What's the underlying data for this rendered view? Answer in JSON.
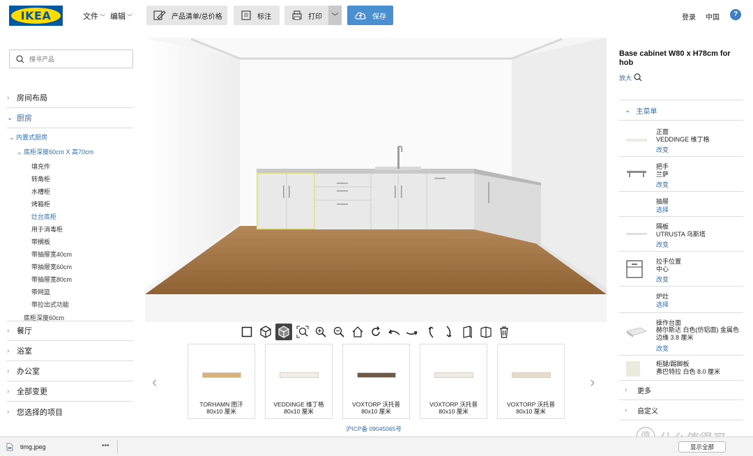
{
  "topbar": {
    "logo_text": "IKEA",
    "menu_file": "文件",
    "menu_edit": "编辑",
    "btn_list": "产品清单/总价格",
    "btn_mark": "标注",
    "btn_print": "打印",
    "btn_save": "保存",
    "login": "登录",
    "region": "中国",
    "help": "?"
  },
  "sidebar": {
    "search_placeholder": "搜寻产品",
    "categories": [
      {
        "label": "房间布局"
      },
      {
        "label": "厨房"
      },
      {
        "label": "餐厅"
      },
      {
        "label": "浴室"
      },
      {
        "label": "办公室"
      },
      {
        "label": "全部变更"
      },
      {
        "label": "您选择的项目"
      }
    ],
    "builtin": "内置式厨房",
    "base_depth": "底柜深度60cm X 高70cm",
    "items": [
      "填充件",
      "转角柜",
      "水槽柜",
      "烤箱柜",
      "灶台底柜",
      "用于消毒柜",
      "带搁板",
      "带抽屉宽40cm",
      "带抽屉宽60cm",
      "带抽屉宽80cm",
      "带网篮",
      "带拉出式功能"
    ],
    "base_depth_2": "底柜深度60cm"
  },
  "cards": [
    {
      "name": "TORHAMN 图汗",
      "size": "80x10 厘米"
    },
    {
      "name": "VEDDINGE 维丁格",
      "size": "80x10 厘米"
    },
    {
      "name": "VOXTORP 沃托普",
      "size": "80x10 厘米"
    },
    {
      "name": "VOXTORP 沃托普",
      "size": "80x10 厘米"
    },
    {
      "name": "VOXTORP 沃托普",
      "size": "80x10 厘米"
    }
  ],
  "colors": {
    "swatches": [
      "#d9b27a",
      "#f2efe9",
      "#6d5a48",
      "#efebe4",
      "#e7dccb"
    ],
    "accent_blue": "#2f6fb5",
    "save_blue": "#4a8fd0"
  },
  "footer": {
    "icp": "沪ICP备 09045065号"
  },
  "panel": {
    "title": "Base cabinet W80 x H78cm for hob",
    "zoom": "放大",
    "main_menu": "主菜单",
    "options": [
      {
        "label": "正面",
        "value": "VEDDINGE 维丁格",
        "action": "改变"
      },
      {
        "label": "把手",
        "value": "兰萨",
        "action": "改变"
      },
      {
        "label": "抽屉",
        "value": "",
        "action": "选择"
      },
      {
        "label": "隔板",
        "value": "UTRUSTA 乌斯塔",
        "action": "改变"
      },
      {
        "label": "拉手位置",
        "value": "中心",
        "action": "改变"
      },
      {
        "label": "炉灶",
        "value": "",
        "action": "选择"
      },
      {
        "label": "操作台面",
        "value": "赫尔斯达 白色(仿铝面) 金属色边缘 3.8 厘米",
        "action": "改变"
      },
      {
        "label": "柜腿/踢脚板",
        "value": "弗巴特拉 白色 8.0 厘米",
        "action": ""
      }
    ],
    "more": "更多",
    "custom": "自定义"
  },
  "download": {
    "file": "timg.jpeg",
    "more": "•••",
    "show_all": "显示全部"
  },
  "watermark": {
    "circle": "值",
    "text": "什么值得买"
  }
}
